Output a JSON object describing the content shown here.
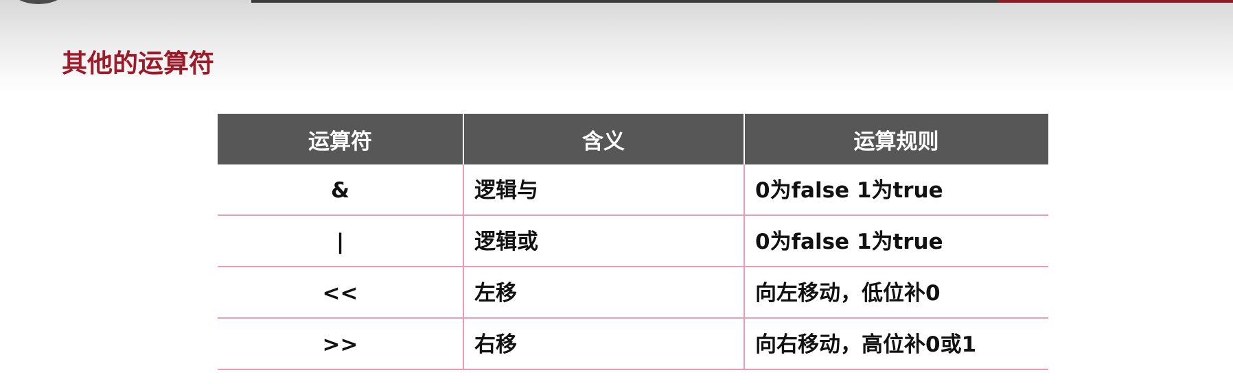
{
  "slide": {
    "title": "其他的运算符"
  },
  "table": {
    "headers": [
      "运算符",
      "含义",
      "运算规则"
    ],
    "rows": [
      {
        "operator": "&",
        "meaning": "逻辑与",
        "rule": "0为false 1为true"
      },
      {
        "operator": "|",
        "meaning": "逻辑或",
        "rule": "0为false 1为true"
      },
      {
        "operator": "<<",
        "meaning": "左移",
        "rule": "向左移动，低位补0"
      },
      {
        "operator": ">>",
        "meaning": "右移",
        "rule": "向右移动，高位补0或1"
      }
    ]
  },
  "colors": {
    "title": "#9b1b2a",
    "header_bg": "#575757",
    "row_border": "#ee9bb8",
    "accent_line": "#8b1b26"
  }
}
